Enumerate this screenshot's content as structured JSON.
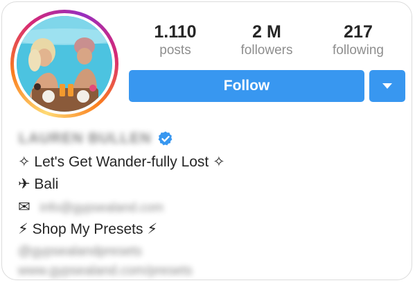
{
  "profile": {
    "name": "LAUREN BULLEN",
    "verified": true
  },
  "stats": {
    "posts": {
      "value": "1.110",
      "label": "posts"
    },
    "followers": {
      "value": "2 M",
      "label": "followers"
    },
    "following": {
      "value": "217",
      "label": "following"
    }
  },
  "actions": {
    "follow_label": "Follow"
  },
  "bio": {
    "line1": "✧ Let's Get Wander-fully Lost ✧",
    "line2": "✈ Bali",
    "email_icon": "✉",
    "email": "info@gypsealand.com",
    "line4": "⚡ Shop My Presets ⚡",
    "handle": "@gypsealandpresets",
    "link": "www.gypsealand.com/presets"
  },
  "colors": {
    "button": "#3897f0",
    "verified": "#3897f0",
    "label_gray": "#8e8e8e",
    "text": "#262626"
  }
}
